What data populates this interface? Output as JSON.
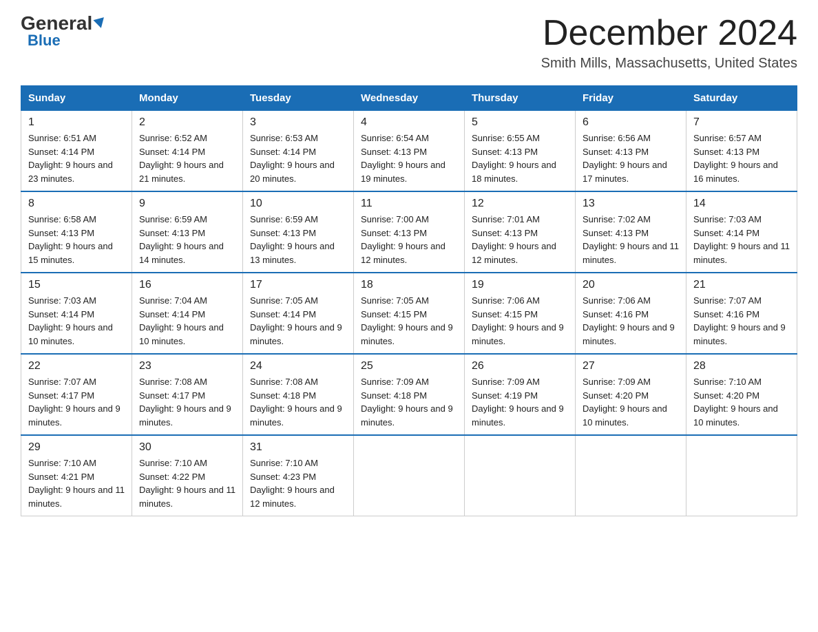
{
  "header": {
    "logo_general": "General",
    "logo_blue": "Blue",
    "month_title": "December 2024",
    "subtitle": "Smith Mills, Massachusetts, United States"
  },
  "weekdays": [
    "Sunday",
    "Monday",
    "Tuesday",
    "Wednesday",
    "Thursday",
    "Friday",
    "Saturday"
  ],
  "weeks": [
    [
      {
        "day": "1",
        "sunrise": "Sunrise: 6:51 AM",
        "sunset": "Sunset: 4:14 PM",
        "daylight": "Daylight: 9 hours and 23 minutes."
      },
      {
        "day": "2",
        "sunrise": "Sunrise: 6:52 AM",
        "sunset": "Sunset: 4:14 PM",
        "daylight": "Daylight: 9 hours and 21 minutes."
      },
      {
        "day": "3",
        "sunrise": "Sunrise: 6:53 AM",
        "sunset": "Sunset: 4:14 PM",
        "daylight": "Daylight: 9 hours and 20 minutes."
      },
      {
        "day": "4",
        "sunrise": "Sunrise: 6:54 AM",
        "sunset": "Sunset: 4:13 PM",
        "daylight": "Daylight: 9 hours and 19 minutes."
      },
      {
        "day": "5",
        "sunrise": "Sunrise: 6:55 AM",
        "sunset": "Sunset: 4:13 PM",
        "daylight": "Daylight: 9 hours and 18 minutes."
      },
      {
        "day": "6",
        "sunrise": "Sunrise: 6:56 AM",
        "sunset": "Sunset: 4:13 PM",
        "daylight": "Daylight: 9 hours and 17 minutes."
      },
      {
        "day": "7",
        "sunrise": "Sunrise: 6:57 AM",
        "sunset": "Sunset: 4:13 PM",
        "daylight": "Daylight: 9 hours and 16 minutes."
      }
    ],
    [
      {
        "day": "8",
        "sunrise": "Sunrise: 6:58 AM",
        "sunset": "Sunset: 4:13 PM",
        "daylight": "Daylight: 9 hours and 15 minutes."
      },
      {
        "day": "9",
        "sunrise": "Sunrise: 6:59 AM",
        "sunset": "Sunset: 4:13 PM",
        "daylight": "Daylight: 9 hours and 14 minutes."
      },
      {
        "day": "10",
        "sunrise": "Sunrise: 6:59 AM",
        "sunset": "Sunset: 4:13 PM",
        "daylight": "Daylight: 9 hours and 13 minutes."
      },
      {
        "day": "11",
        "sunrise": "Sunrise: 7:00 AM",
        "sunset": "Sunset: 4:13 PM",
        "daylight": "Daylight: 9 hours and 12 minutes."
      },
      {
        "day": "12",
        "sunrise": "Sunrise: 7:01 AM",
        "sunset": "Sunset: 4:13 PM",
        "daylight": "Daylight: 9 hours and 12 minutes."
      },
      {
        "day": "13",
        "sunrise": "Sunrise: 7:02 AM",
        "sunset": "Sunset: 4:13 PM",
        "daylight": "Daylight: 9 hours and 11 minutes."
      },
      {
        "day": "14",
        "sunrise": "Sunrise: 7:03 AM",
        "sunset": "Sunset: 4:14 PM",
        "daylight": "Daylight: 9 hours and 11 minutes."
      }
    ],
    [
      {
        "day": "15",
        "sunrise": "Sunrise: 7:03 AM",
        "sunset": "Sunset: 4:14 PM",
        "daylight": "Daylight: 9 hours and 10 minutes."
      },
      {
        "day": "16",
        "sunrise": "Sunrise: 7:04 AM",
        "sunset": "Sunset: 4:14 PM",
        "daylight": "Daylight: 9 hours and 10 minutes."
      },
      {
        "day": "17",
        "sunrise": "Sunrise: 7:05 AM",
        "sunset": "Sunset: 4:14 PM",
        "daylight": "Daylight: 9 hours and 9 minutes."
      },
      {
        "day": "18",
        "sunrise": "Sunrise: 7:05 AM",
        "sunset": "Sunset: 4:15 PM",
        "daylight": "Daylight: 9 hours and 9 minutes."
      },
      {
        "day": "19",
        "sunrise": "Sunrise: 7:06 AM",
        "sunset": "Sunset: 4:15 PM",
        "daylight": "Daylight: 9 hours and 9 minutes."
      },
      {
        "day": "20",
        "sunrise": "Sunrise: 7:06 AM",
        "sunset": "Sunset: 4:16 PM",
        "daylight": "Daylight: 9 hours and 9 minutes."
      },
      {
        "day": "21",
        "sunrise": "Sunrise: 7:07 AM",
        "sunset": "Sunset: 4:16 PM",
        "daylight": "Daylight: 9 hours and 9 minutes."
      }
    ],
    [
      {
        "day": "22",
        "sunrise": "Sunrise: 7:07 AM",
        "sunset": "Sunset: 4:17 PM",
        "daylight": "Daylight: 9 hours and 9 minutes."
      },
      {
        "day": "23",
        "sunrise": "Sunrise: 7:08 AM",
        "sunset": "Sunset: 4:17 PM",
        "daylight": "Daylight: 9 hours and 9 minutes."
      },
      {
        "day": "24",
        "sunrise": "Sunrise: 7:08 AM",
        "sunset": "Sunset: 4:18 PM",
        "daylight": "Daylight: 9 hours and 9 minutes."
      },
      {
        "day": "25",
        "sunrise": "Sunrise: 7:09 AM",
        "sunset": "Sunset: 4:18 PM",
        "daylight": "Daylight: 9 hours and 9 minutes."
      },
      {
        "day": "26",
        "sunrise": "Sunrise: 7:09 AM",
        "sunset": "Sunset: 4:19 PM",
        "daylight": "Daylight: 9 hours and 9 minutes."
      },
      {
        "day": "27",
        "sunrise": "Sunrise: 7:09 AM",
        "sunset": "Sunset: 4:20 PM",
        "daylight": "Daylight: 9 hours and 10 minutes."
      },
      {
        "day": "28",
        "sunrise": "Sunrise: 7:10 AM",
        "sunset": "Sunset: 4:20 PM",
        "daylight": "Daylight: 9 hours and 10 minutes."
      }
    ],
    [
      {
        "day": "29",
        "sunrise": "Sunrise: 7:10 AM",
        "sunset": "Sunset: 4:21 PM",
        "daylight": "Daylight: 9 hours and 11 minutes."
      },
      {
        "day": "30",
        "sunrise": "Sunrise: 7:10 AM",
        "sunset": "Sunset: 4:22 PM",
        "daylight": "Daylight: 9 hours and 11 minutes."
      },
      {
        "day": "31",
        "sunrise": "Sunrise: 7:10 AM",
        "sunset": "Sunset: 4:23 PM",
        "daylight": "Daylight: 9 hours and 12 minutes."
      },
      null,
      null,
      null,
      null
    ]
  ]
}
